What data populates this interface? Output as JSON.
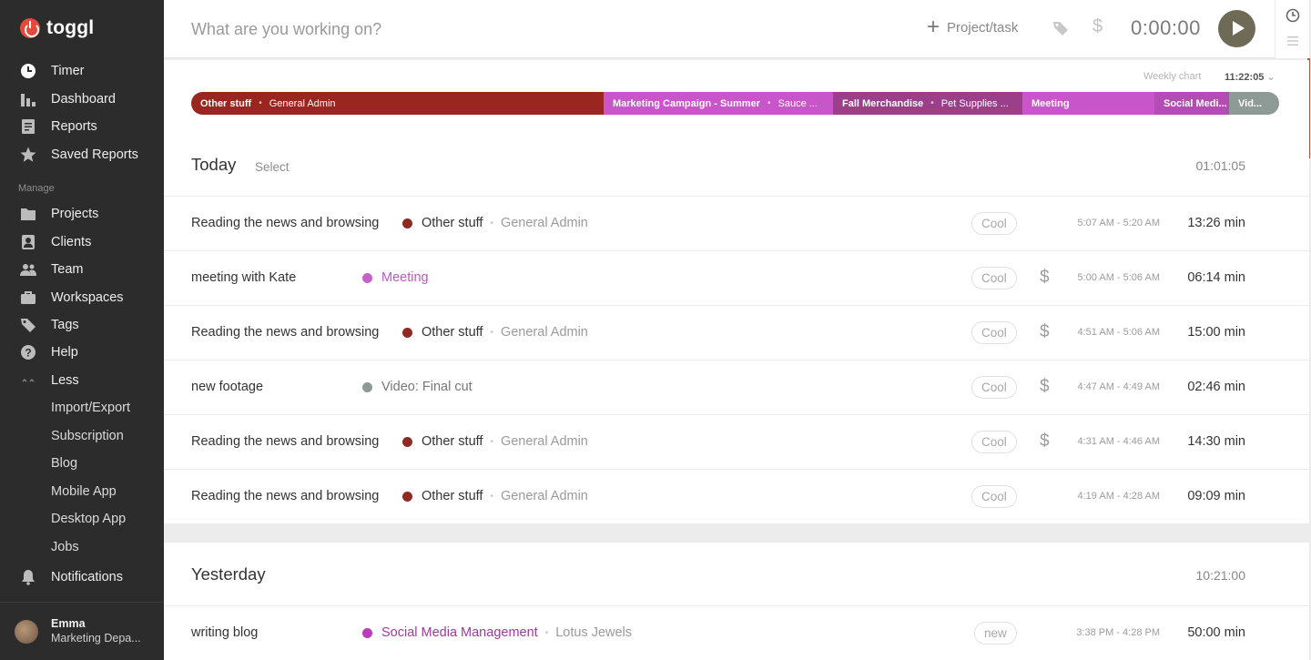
{
  "app": {
    "logo_text": "toggl"
  },
  "sidebar": {
    "items": [
      {
        "label": "Timer",
        "icon": "clock-icon"
      },
      {
        "label": "Dashboard",
        "icon": "bar-chart-icon"
      },
      {
        "label": "Reports",
        "icon": "report-icon"
      },
      {
        "label": "Saved Reports",
        "icon": "star-icon"
      }
    ],
    "manage_label": "Manage",
    "manage_items": [
      {
        "label": "Projects",
        "icon": "folder-icon"
      },
      {
        "label": "Clients",
        "icon": "client-icon"
      },
      {
        "label": "Team",
        "icon": "team-icon"
      },
      {
        "label": "Workspaces",
        "icon": "briefcase-icon"
      },
      {
        "label": "Tags",
        "icon": "tag-icon"
      },
      {
        "label": "Help",
        "icon": "help-icon"
      },
      {
        "label": "Less",
        "icon": "less-icon"
      }
    ],
    "extra_items": [
      "Import/Export",
      "Subscription",
      "Blog",
      "Mobile App",
      "Desktop App",
      "Jobs"
    ],
    "notifications": {
      "label": "Notifications",
      "icon": "bell-icon"
    },
    "user": {
      "name": "Emma",
      "workspace": "Marketing Depa..."
    }
  },
  "timer": {
    "placeholder": "What are you working on?",
    "project_label": "Project/task",
    "elapsed": "0:00:00"
  },
  "weekly": {
    "label": "Weekly chart",
    "total": "11:22:05",
    "segments": [
      {
        "project": "Other stuff",
        "client": "General Admin",
        "color": "#9a2620"
      },
      {
        "project": "Marketing Campaign - Summer",
        "client": "Sauce ...",
        "color": "#c855c9"
      },
      {
        "project": "Fall Merchandise",
        "client": "Pet Supplies ...",
        "color": "#9b3f8a"
      },
      {
        "project": "Meeting",
        "client": "",
        "color": "#c855c9"
      },
      {
        "project": "Social Medi...",
        "client": "",
        "color": "#b44db3"
      },
      {
        "project": "Vid...",
        "client": "",
        "color": "#8e9a96"
      }
    ]
  },
  "groups": [
    {
      "title": "Today",
      "select_label": "Select",
      "total": "01:01:05",
      "entries": [
        {
          "description": "Reading the news and browsing",
          "project": "Other stuff",
          "client": "General Admin",
          "color": "#8e2a22",
          "tag": "Cool",
          "billable": false,
          "range": "5:07 AM - 5:20 AM",
          "duration": "13:26 min"
        },
        {
          "description": "meeting with Kate",
          "project": "Meeting",
          "client": "",
          "color": "#c462cc",
          "tag": "Cool",
          "billable": true,
          "range": "5:00 AM - 5:06 AM",
          "duration": "06:14 min"
        },
        {
          "description": "Reading the news and browsing",
          "project": "Other stuff",
          "client": "General Admin",
          "color": "#8e2a22",
          "tag": "Cool",
          "billable": true,
          "range": "4:51 AM - 5:06 AM",
          "duration": "15:00 min"
        },
        {
          "description": "new footage",
          "project": "Video: Final cut",
          "client": "",
          "color": "#8e9a94",
          "tag": "Cool",
          "billable": true,
          "range": "4:47 AM - 4:49 AM",
          "duration": "02:46 min"
        },
        {
          "description": "Reading the news and browsing",
          "project": "Other stuff",
          "client": "General Admin",
          "color": "#8e2a22",
          "tag": "Cool",
          "billable": true,
          "range": "4:31 AM - 4:46 AM",
          "duration": "14:30 min"
        },
        {
          "description": "Reading the news and browsing",
          "project": "Other stuff",
          "client": "General Admin",
          "color": "#8e2a22",
          "tag": "Cool",
          "billable": false,
          "range": "4:19 AM - 4:28 AM",
          "duration": "09:09 min"
        }
      ]
    },
    {
      "title": "Yesterday",
      "select_label": "",
      "total": "10:21:00",
      "entries": [
        {
          "description": "writing blog",
          "project": "Social Media Management",
          "client": "Lotus Jewels",
          "color": "#b83fb8",
          "tag": "new",
          "billable": false,
          "range": "3:38 PM - 4:28 PM",
          "duration": "50:00 min"
        }
      ]
    }
  ]
}
